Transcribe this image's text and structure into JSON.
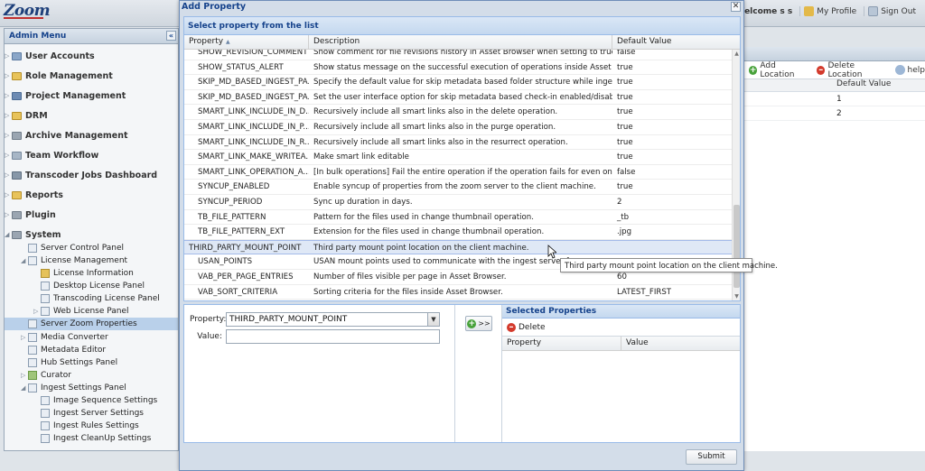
{
  "app": {
    "logo": "Zoom",
    "topnav": {
      "welcome": "Welcome s s",
      "profile": "My Profile",
      "signout": "Sign Out"
    }
  },
  "sidebar": {
    "title": "Admin Menu",
    "collapse_glyph": "«",
    "items": [
      {
        "label": "User Accounts"
      },
      {
        "label": "Role Management"
      },
      {
        "label": "Project Management"
      },
      {
        "label": "DRM"
      },
      {
        "label": "Archive Management"
      },
      {
        "label": "Team Workflow"
      },
      {
        "label": "Transcoder Jobs Dashboard"
      },
      {
        "label": "Reports"
      },
      {
        "label": "Plugin"
      },
      {
        "label": "System"
      }
    ],
    "sub": [
      {
        "label": "Server Control Panel"
      },
      {
        "label": "License Management"
      },
      {
        "label": "License Information"
      },
      {
        "label": "Desktop License Panel"
      },
      {
        "label": "Transcoding License Panel"
      },
      {
        "label": "Web License Panel"
      },
      {
        "label": "Server Zoom Properties"
      },
      {
        "label": "Media Converter"
      },
      {
        "label": "Metadata Editor"
      },
      {
        "label": "Hub Settings Panel"
      },
      {
        "label": "Curator"
      },
      {
        "label": "Ingest Settings Panel"
      },
      {
        "label": "Image Sequence Settings"
      },
      {
        "label": "Ingest Server Settings"
      },
      {
        "label": "Ingest Rules Settings"
      },
      {
        "label": "Ingest CleanUp Settings"
      }
    ]
  },
  "background_panel": {
    "toolbar": {
      "add": "Add Location",
      "delete": "Delete Location",
      "help": "help"
    },
    "column": "Default Value",
    "rows": [
      "1",
      "2"
    ]
  },
  "modal": {
    "title": "Add Property",
    "close_glyph": "✕",
    "list_title": "Select property from the list",
    "columns": {
      "property": "Property",
      "sort_glyph": "▲",
      "description": "Description",
      "default": "Default Value"
    },
    "rows": [
      {
        "property": "SHOW_REVISION_COMMENT",
        "description": "Show comment for file revisions history in Asset Browser when setting to true.",
        "default": "false"
      },
      {
        "property": "SHOW_STATUS_ALERT",
        "description": "Show status message on the successful execution of operations inside Asset Br...",
        "default": "true"
      },
      {
        "property": "SKIP_MD_BASED_INGEST_PA...",
        "description": "Specify the default value for skip metadata based folder structure while ingesti...",
        "default": "true"
      },
      {
        "property": "SKIP_MD_BASED_INGEST_PA...",
        "description": "Set the user interface option for skip metadata based check-in enabled/disabled.",
        "default": "true"
      },
      {
        "property": "SMART_LINK_INCLUDE_IN_D...",
        "description": "Recursively include all smart links also in the delete operation.",
        "default": "true"
      },
      {
        "property": "SMART_LINK_INCLUDE_IN_P...",
        "description": "Recursively include all smart links also in the purge operation.",
        "default": "true"
      },
      {
        "property": "SMART_LINK_INCLUDE_IN_R...",
        "description": "Recursively include all smart links also in the resurrect operation.",
        "default": "true"
      },
      {
        "property": "SMART_LINK_MAKE_WRITEA...",
        "description": "Make smart link editable",
        "default": "true"
      },
      {
        "property": "SMART_LINK_OPERATION_A...",
        "description": "[In bulk operations] Fail the entire operation if the operation fails for even one ...",
        "default": "false"
      },
      {
        "property": "SYNCUP_ENABLED",
        "description": "Enable syncup of properties from the zoom server to the client machine.",
        "default": "true"
      },
      {
        "property": "SYNCUP_PERIOD",
        "description": "Sync up duration in days.",
        "default": "2"
      },
      {
        "property": "TB_FILE_PATTERN",
        "description": "Pattern for the files used in change thumbnail operation.",
        "default": "_tb"
      },
      {
        "property": "TB_FILE_PATTERN_EXT",
        "description": "Extension for the files used in change thumbnail operation.",
        "default": ".jpg"
      },
      {
        "property": "THIRD_PARTY_MOUNT_POINT",
        "description": "Third party mount point location on the client machine.",
        "default": ""
      },
      {
        "property": "USAN_POINTS",
        "description": "USAN mount points used to communicate with the ingest server for",
        "default": ""
      },
      {
        "property": "VAB_PER_PAGE_ENTRIES",
        "description": "Number of files visible per page in Asset Browser.",
        "default": "60"
      },
      {
        "property": "VAB_SORT_CRITERIA",
        "description": "Sorting criteria for the files inside Asset Browser.",
        "default": "LATEST_FIRST"
      }
    ],
    "tooltip": "Third party mount point location on the client machine.",
    "form": {
      "property_label": "Property:",
      "property_value": "THIRD_PARTY_MOUNT_POINT",
      "value_label": "Value:",
      "value_value": ""
    },
    "move_label": ">>",
    "selected": {
      "title": "Selected Properties",
      "delete": "Delete",
      "col_property": "Property",
      "col_value": "Value"
    },
    "submit": "Submit"
  },
  "colors": {
    "header_blue": "#15428b",
    "selection": "#dfe8f6",
    "modal_bg": "#d3dde9"
  }
}
